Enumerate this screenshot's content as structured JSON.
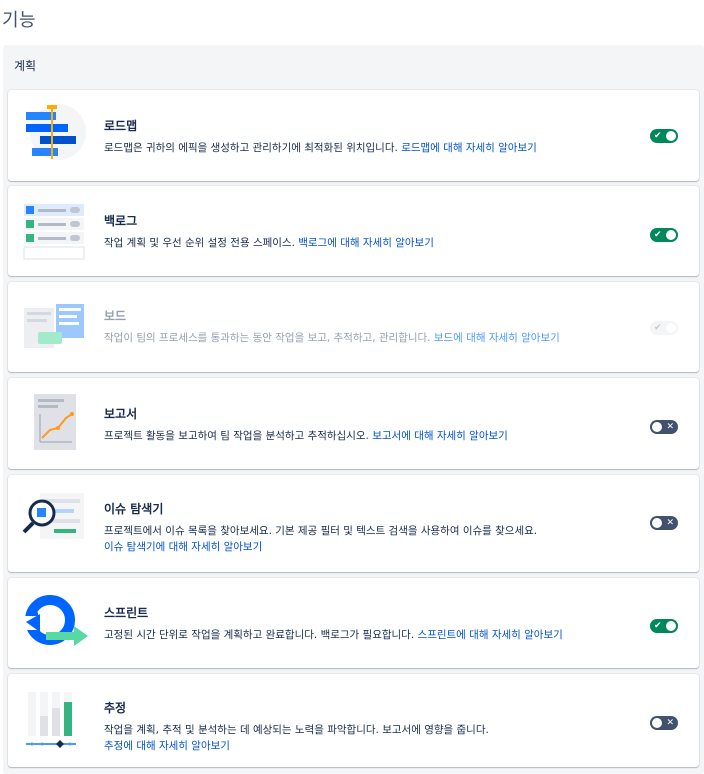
{
  "page_title": "기능",
  "section_title": "계획",
  "features": [
    {
      "name": "로드맵",
      "desc": "로드맵은 귀하의 에픽을 생성하고 관리하기에 최적화된 위치입니다.",
      "link": "로드맵에 대해 자세히 알아보기",
      "toggle": "on",
      "icon": "roadmap-illustration"
    },
    {
      "name": "백로그",
      "desc": "작업 계획 및 우선 순위 설정 전용 스페이스.",
      "link": "백로그에 대해 자세히 알아보기",
      "toggle": "on",
      "icon": "backlog-illustration"
    },
    {
      "name": "보드",
      "desc": "작업이 팀의 프로세스를 통과하는 동안 작업을 보고, 추적하고, 관리합니다.",
      "link": "보드에 대해 자세히 알아보기",
      "toggle": "disabled",
      "icon": "board-illustration"
    },
    {
      "name": "보고서",
      "desc": "프로젝트 활동을 보고하여 팀 작업을 분석하고 추적하십시오.",
      "link": "보고서에 대해 자세히 알아보기",
      "toggle": "off",
      "icon": "reports-illustration"
    },
    {
      "name": "이슈 탐색기",
      "desc": "프로젝트에서 이슈 목록을 찾아보세요. 기본 제공 필터 및 텍스트 검색을 사용하여 이슈를 찾으세요.",
      "link": "이슈 탐색기에 대해 자세히 알아보기",
      "toggle": "off",
      "icon": "issue-navigator-illustration"
    },
    {
      "name": "스프린트",
      "desc": "고정된 시간 단위로 작업을 계획하고 완료합니다. 백로그가 필요합니다.",
      "link": "스프린트에 대해 자세히 알아보기",
      "toggle": "on",
      "icon": "sprint-illustration"
    },
    {
      "name": "추정",
      "desc": "작업을 계획, 추적 및 분석하는 데 예상되는 노력을 파악합니다. 보고서에 영향을 줍니다.",
      "link": "추정에 대해 자세히 알아보기",
      "toggle": "off",
      "icon": "estimation-illustration"
    }
  ],
  "toggle_symbols": {
    "on": "✔",
    "off": "✕"
  },
  "colors": {
    "toggle_on": "#00875a",
    "toggle_off": "#42526e",
    "link": "#0052cc"
  }
}
